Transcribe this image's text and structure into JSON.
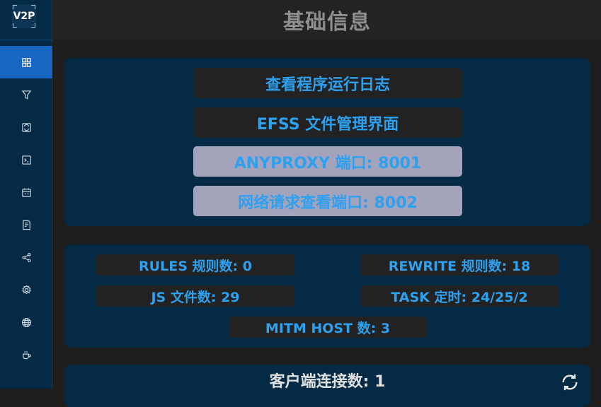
{
  "logo": {
    "text": "V2P"
  },
  "header": {
    "title": "基础信息"
  },
  "sidebar": {
    "items": [
      {
        "icon": "dashboard-icon",
        "active": true
      },
      {
        "icon": "filter-icon",
        "active": false
      },
      {
        "icon": "rewrite-icon",
        "active": false
      },
      {
        "icon": "terminal-icon",
        "active": false
      },
      {
        "icon": "calendar-icon",
        "active": false
      },
      {
        "icon": "document-icon",
        "active": false
      },
      {
        "icon": "share-icon",
        "active": false
      },
      {
        "icon": "gear-icon",
        "active": false
      },
      {
        "icon": "globe-icon",
        "active": false
      },
      {
        "icon": "coffee-icon",
        "active": false
      }
    ]
  },
  "links": {
    "logs": "查看程序运行日志",
    "efss": "EFSS 文件管理界面",
    "anyproxy": "ANYPROXY 端口: 8001",
    "network": "网络请求查看端口: 8002"
  },
  "stats": {
    "rules": "RULES 规则数: 0",
    "rewrite": "REWRITE 规则数: 18",
    "js": "JS 文件数: 29",
    "task": "TASK 定时: 24/25/2",
    "mitm": "MITM HOST 数: 3"
  },
  "client": {
    "title": "客户端连接数: 1"
  },
  "colors": {
    "sidebar_bg": "#042a45",
    "active_bg": "#1766c2",
    "accent_text": "#2ea0f0",
    "card_bg": "#042a45",
    "page_bg": "#1e1e1e"
  }
}
